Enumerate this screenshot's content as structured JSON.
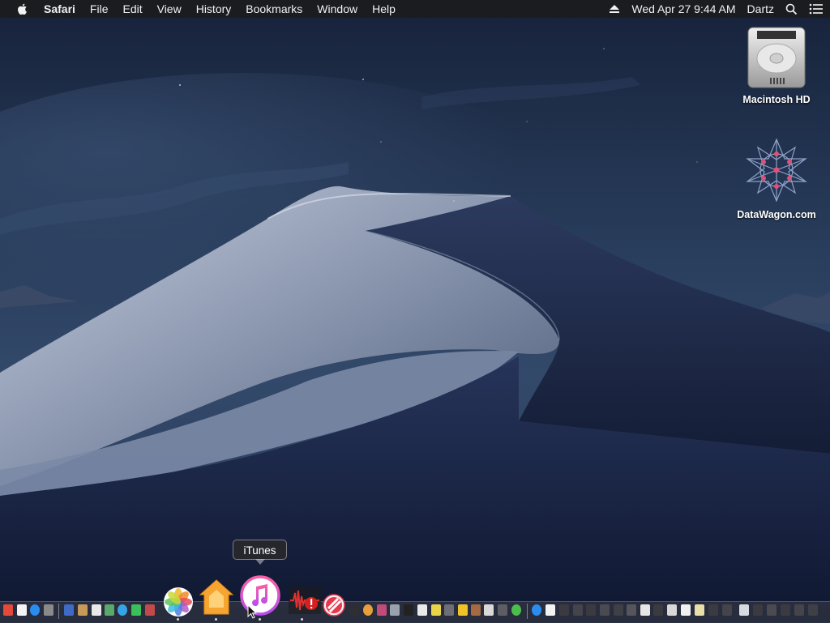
{
  "menubar": {
    "app_name": "Safari",
    "menus": [
      "File",
      "Edit",
      "View",
      "History",
      "Bookmarks",
      "Window",
      "Help"
    ],
    "clock": "Wed Apr 27  9:44 AM",
    "user": "Dartz"
  },
  "desktop_icons": [
    {
      "label": "Macintosh HD",
      "icon": "hard-drive-icon"
    },
    {
      "label": "DataWagon.com",
      "icon": "datawagon-star-icon"
    }
  ],
  "tooltip": {
    "text": "iTunes"
  },
  "dock": {
    "large_items": [
      {
        "name": "Photos",
        "icon": "photos-icon"
      },
      {
        "name": "Home",
        "icon": "home-icon"
      },
      {
        "name": "iTunes",
        "icon": "itunes-icon"
      },
      {
        "name": "Audio Editor",
        "icon": "audio-waveform-icon"
      },
      {
        "name": "News",
        "icon": "news-icon"
      }
    ]
  },
  "colors": {
    "sky_top": "#1c2840",
    "sky_mid": "#2f4362",
    "dune_light": "#b9c3d4",
    "dune_dark": "#1e2a47",
    "menubar_bg": "#1c1c1e",
    "itunes_pink": "#f04b8c"
  }
}
